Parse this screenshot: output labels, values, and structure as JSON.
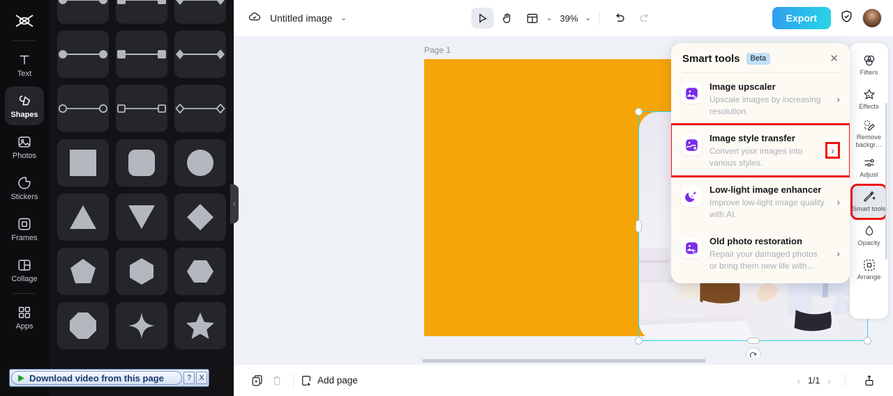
{
  "left_rail": {
    "logo": "capcut-logo",
    "items": [
      {
        "label": "Text",
        "icon": "text-icon",
        "active": false
      },
      {
        "label": "Shapes",
        "icon": "shapes-icon",
        "active": true
      },
      {
        "label": "Photos",
        "icon": "photos-icon",
        "active": false
      },
      {
        "label": "Stickers",
        "icon": "stickers-icon",
        "active": false
      },
      {
        "label": "Frames",
        "icon": "frames-icon",
        "active": false
      },
      {
        "label": "Collage",
        "icon": "collage-icon",
        "active": false
      },
      {
        "label": "Apps",
        "icon": "apps-icon",
        "active": false
      }
    ]
  },
  "shapes_panel": {
    "collapse_handle": "‹",
    "cells": [
      "line-dot-dot-partial",
      "line-square-square-partial",
      "line-diamond-diamond-partial",
      "line-dot-dot",
      "line-square-square",
      "line-diamond-diamond",
      "line-circle-outline",
      "line-square-outline",
      "line-diamond-outline",
      "square",
      "rounded-square",
      "circle",
      "triangle-up",
      "triangle-down",
      "diamond",
      "pentagon",
      "hexagon-vertical",
      "hexagon-horizontal",
      "octagon",
      "four-point-star",
      "five-point-star"
    ]
  },
  "download_helper": {
    "label": "Download video from this page",
    "help_label": "?",
    "close_label": "X"
  },
  "topbar": {
    "cloud_icon": "cloud-saved-icon",
    "doc_title": "Untitled image",
    "title_caret": "⌄",
    "tools": [
      {
        "name": "select-tool",
        "icon": "cursor-arrow-icon",
        "active": true
      },
      {
        "name": "hand-tool",
        "icon": "hand-icon",
        "active": false
      },
      {
        "name": "layout-tool",
        "icon": "layout-icon",
        "active": false
      }
    ],
    "layout_caret": "⌄",
    "zoom_level": "39%",
    "zoom_caret": "⌄",
    "undo_icon": "undo-icon",
    "redo_icon": "redo-icon",
    "export_label": "Export",
    "shield_icon": "shield-check-icon",
    "avatar": "user-avatar"
  },
  "canvas": {
    "page_label": "Page 1",
    "artboard_color": "#F5A508",
    "selection_color": "#2ED3E6",
    "float_toolbar": [
      {
        "name": "cutout-button",
        "icon": "cutout-dashed-icon"
      },
      {
        "name": "replace-button",
        "icon": "replace-swap-icon"
      },
      {
        "name": "duplicate-button",
        "icon": "duplicate-icon"
      },
      {
        "name": "more-button",
        "icon": "more-dots-icon"
      }
    ],
    "rotate_handle": "↻"
  },
  "smart_tools": {
    "title": "Smart tools",
    "badge": "Beta",
    "close_label": "✕",
    "arrow": "›",
    "items": [
      {
        "name": "Image upscaler",
        "desc": "Upscale images by increasing resolution.",
        "icon": "image-4k-upscale-icon",
        "highlighted": false
      },
      {
        "name": "Image style transfer",
        "desc": "Convert your images into various styles.",
        "icon": "image-style-transfer-icon",
        "highlighted": true
      },
      {
        "name": "Low-light image enhancer",
        "desc": "Improve low-light image quality with AI.",
        "icon": "moon-stars-icon",
        "highlighted": false
      },
      {
        "name": "Old photo restoration",
        "desc": "Repair your damaged photos or bring them new life with…",
        "icon": "old-photo-restore-icon",
        "highlighted": false
      }
    ]
  },
  "right_rail": {
    "items": [
      {
        "label": "Filters",
        "icon": "filters-icon",
        "active": false
      },
      {
        "label": "Effects",
        "icon": "effects-icon",
        "active": false
      },
      {
        "label": "Remove backgr…",
        "icon": "remove-bg-icon",
        "active": false
      },
      {
        "label": "Adjust",
        "icon": "adjust-icon",
        "active": false
      },
      {
        "label": "Smart tools",
        "icon": "smart-tools-icon",
        "active": true
      },
      {
        "label": "Opacity",
        "icon": "opacity-icon",
        "active": false
      },
      {
        "label": "Arrange",
        "icon": "arrange-icon",
        "active": false
      }
    ]
  },
  "bottombar": {
    "duplicate_icon": "duplicate-page-icon",
    "delete_icon": "trash-icon",
    "add_page_icon": "add-page-icon",
    "add_page_label": "Add page",
    "prev_label": "‹",
    "page_count": "1/1",
    "next_label": "›",
    "export_page_icon": "export-page-icon"
  },
  "highlight_color": "#EE1111"
}
